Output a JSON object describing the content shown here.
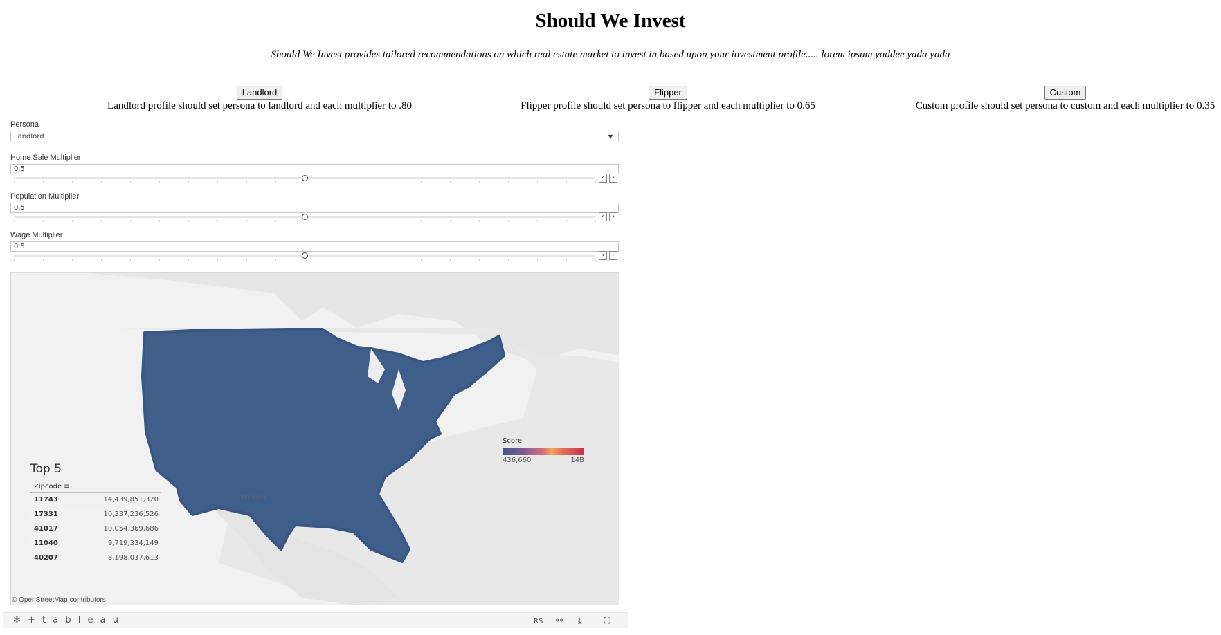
{
  "header": {
    "title": "Should We Invest",
    "subtitle": "Should We Invest provides tailored recommendations on which real estate market to invest in based upon your investment profile..... lorem ipsum yaddee yada yada"
  },
  "profiles": [
    {
      "button": "Landlord",
      "description": "Landlord profile should set persona to landlord and each multiplier to .80"
    },
    {
      "button": "Flipper",
      "description": "Flipper profile should set persona to flipper and each multiplier to 0.65"
    },
    {
      "button": "Custom",
      "description": "Custom profile should set persona to custom and each multiplier to 0.35"
    }
  ],
  "viz": {
    "persona": {
      "label": "Persona",
      "value": "Landlord"
    },
    "home_sale": {
      "label": "Home Sale Multiplier",
      "value": "0.5",
      "level": 0.5
    },
    "population": {
      "label": "Population Multiplier",
      "value": "0.5",
      "level": 0.5
    },
    "wage": {
      "label": "Wage Multiplier",
      "value": "0.5",
      "level": 0.5
    },
    "map": {
      "country_label": "Mexico",
      "attribution": "© OpenStreetMap contributors",
      "fill_color": "#3f5f8a"
    },
    "legend": {
      "title": "Score",
      "min_label": "436,660",
      "max_label": "14B"
    },
    "top5": {
      "title": "Top 5",
      "column": "Zipcode",
      "rows": [
        {
          "zip": "11743",
          "score": "14,439,851,320"
        },
        {
          "zip": "17331",
          "score": "10,337,236,526"
        },
        {
          "zip": "41017",
          "score": "10,054,369,686"
        },
        {
          "zip": "11040",
          "score": "9,719,334,149"
        },
        {
          "zip": "40207",
          "score": "8,198,037,613"
        }
      ]
    },
    "toolbar": {
      "logo": "+ t a b l e a u",
      "user_initials": "RS"
    }
  }
}
